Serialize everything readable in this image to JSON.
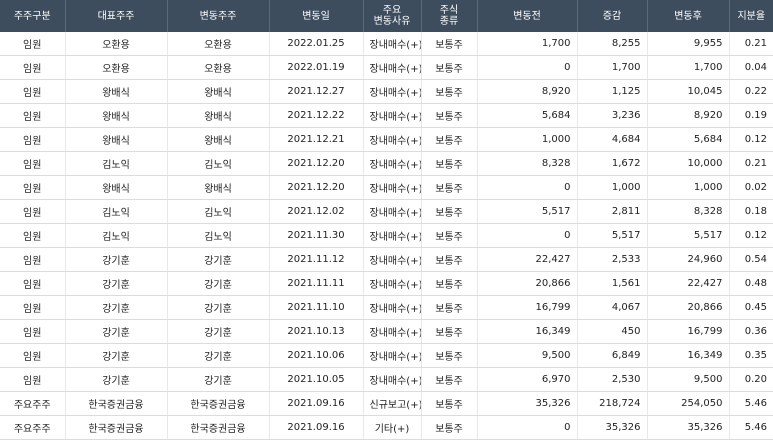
{
  "headers": {
    "holder_type": "주주구분",
    "representative": "대표주주",
    "changed_holder": "변동주주",
    "change_date": "변동일",
    "reason_line1": "주요",
    "reason_line2": "변동사유",
    "stock_line1": "주식",
    "stock_line2": "종류",
    "before": "변동전",
    "delta": "증감",
    "after": "변동후",
    "ratio": "지분율"
  },
  "rows": [
    {
      "type": "임원",
      "rep": "오환용",
      "holder": "오환용",
      "date": "2022.01.25",
      "reason": "장내매수(+)",
      "stock": "보통주",
      "before": "1,700",
      "delta": "8,255",
      "after": "9,955",
      "ratio": "0.21"
    },
    {
      "type": "임원",
      "rep": "오환용",
      "holder": "오환용",
      "date": "2022.01.19",
      "reason": "장내매수(+)",
      "stock": "보통주",
      "before": "0",
      "delta": "1,700",
      "after": "1,700",
      "ratio": "0.04"
    },
    {
      "type": "임원",
      "rep": "왕배식",
      "holder": "왕배식",
      "date": "2021.12.27",
      "reason": "장내매수(+)",
      "stock": "보통주",
      "before": "8,920",
      "delta": "1,125",
      "after": "10,045",
      "ratio": "0.22"
    },
    {
      "type": "임원",
      "rep": "왕배식",
      "holder": "왕배식",
      "date": "2021.12.22",
      "reason": "장내매수(+)",
      "stock": "보통주",
      "before": "5,684",
      "delta": "3,236",
      "after": "8,920",
      "ratio": "0.19"
    },
    {
      "type": "임원",
      "rep": "왕배식",
      "holder": "왕배식",
      "date": "2021.12.21",
      "reason": "장내매수(+)",
      "stock": "보통주",
      "before": "1,000",
      "delta": "4,684",
      "after": "5,684",
      "ratio": "0.12"
    },
    {
      "type": "임원",
      "rep": "김노익",
      "holder": "김노익",
      "date": "2021.12.20",
      "reason": "장내매수(+)",
      "stock": "보통주",
      "before": "8,328",
      "delta": "1,672",
      "after": "10,000",
      "ratio": "0.21"
    },
    {
      "type": "임원",
      "rep": "왕배식",
      "holder": "왕배식",
      "date": "2021.12.20",
      "reason": "장내매수(+)",
      "stock": "보통주",
      "before": "0",
      "delta": "1,000",
      "after": "1,000",
      "ratio": "0.02"
    },
    {
      "type": "임원",
      "rep": "김노익",
      "holder": "김노익",
      "date": "2021.12.02",
      "reason": "장내매수(+)",
      "stock": "보통주",
      "before": "5,517",
      "delta": "2,811",
      "after": "8,328",
      "ratio": "0.18"
    },
    {
      "type": "임원",
      "rep": "김노익",
      "holder": "김노익",
      "date": "2021.11.30",
      "reason": "장내매수(+)",
      "stock": "보통주",
      "before": "0",
      "delta": "5,517",
      "after": "5,517",
      "ratio": "0.12"
    },
    {
      "type": "임원",
      "rep": "강기훈",
      "holder": "강기훈",
      "date": "2021.11.12",
      "reason": "장내매수(+)",
      "stock": "보통주",
      "before": "22,427",
      "delta": "2,533",
      "after": "24,960",
      "ratio": "0.54"
    },
    {
      "type": "임원",
      "rep": "강기훈",
      "holder": "강기훈",
      "date": "2021.11.11",
      "reason": "장내매수(+)",
      "stock": "보통주",
      "before": "20,866",
      "delta": "1,561",
      "after": "22,427",
      "ratio": "0.48"
    },
    {
      "type": "임원",
      "rep": "강기훈",
      "holder": "강기훈",
      "date": "2021.11.10",
      "reason": "장내매수(+)",
      "stock": "보통주",
      "before": "16,799",
      "delta": "4,067",
      "after": "20,866",
      "ratio": "0.45"
    },
    {
      "type": "임원",
      "rep": "강기훈",
      "holder": "강기훈",
      "date": "2021.10.13",
      "reason": "장내매수(+)",
      "stock": "보통주",
      "before": "16,349",
      "delta": "450",
      "after": "16,799",
      "ratio": "0.36"
    },
    {
      "type": "임원",
      "rep": "강기훈",
      "holder": "강기훈",
      "date": "2021.10.06",
      "reason": "장내매수(+)",
      "stock": "보통주",
      "before": "9,500",
      "delta": "6,849",
      "after": "16,349",
      "ratio": "0.35"
    },
    {
      "type": "임원",
      "rep": "강기훈",
      "holder": "강기훈",
      "date": "2021.10.05",
      "reason": "장내매수(+)",
      "stock": "보통주",
      "before": "6,970",
      "delta": "2,530",
      "after": "9,500",
      "ratio": "0.20"
    },
    {
      "type": "주요주주",
      "rep": "한국증권금융",
      "holder": "한국증권금융",
      "date": "2021.09.16",
      "reason": "신규보고(+)",
      "stock": "보통주",
      "before": "35,326",
      "delta": "218,724",
      "after": "254,050",
      "ratio": "5.46"
    },
    {
      "type": "주요주주",
      "rep": "한국증권금융",
      "holder": "한국증권금융",
      "date": "2021.09.16",
      "reason": "기타(+)",
      "stock": "보통주",
      "before": "0",
      "delta": "35,326",
      "after": "35,326",
      "ratio": "5.46"
    }
  ]
}
